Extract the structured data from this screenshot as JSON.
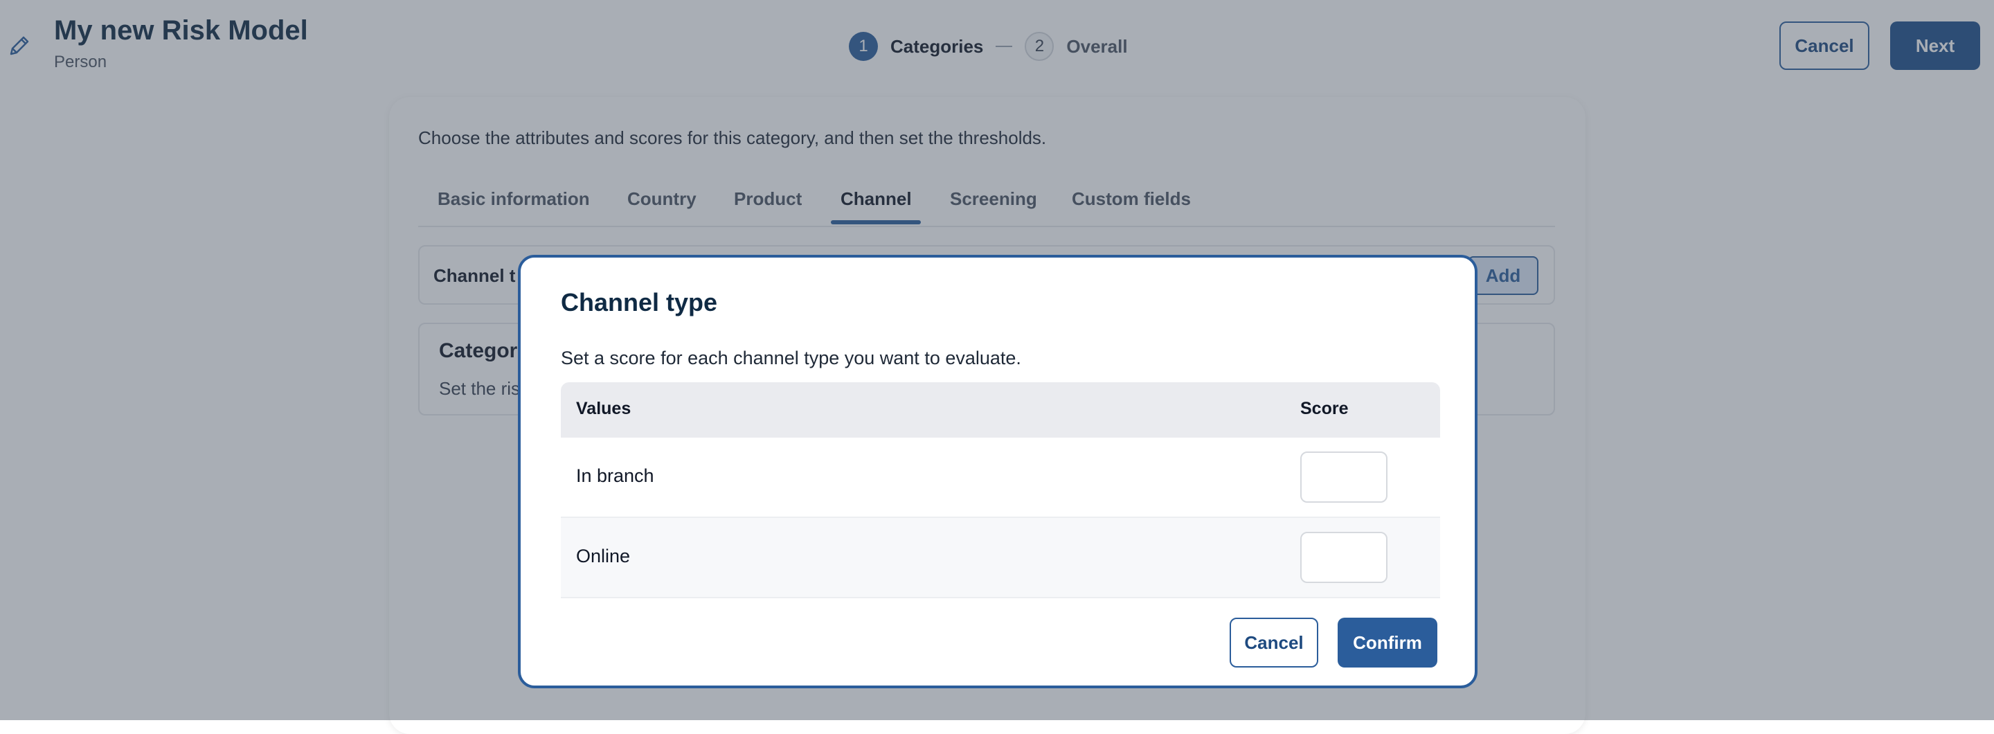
{
  "header": {
    "title": "My new Risk Model",
    "subtitle": "Person",
    "edit_icon": "pencil-icon",
    "steps": [
      {
        "number": "1",
        "label": "Categories",
        "active": true
      },
      {
        "number": "2",
        "label": "Overall",
        "active": false
      }
    ],
    "cancel_label": "Cancel",
    "next_label": "Next"
  },
  "main": {
    "intro": "Choose the attributes and scores for this category, and then set the thresholds.",
    "tabs": [
      {
        "label": "Basic information"
      },
      {
        "label": "Country"
      },
      {
        "label": "Product"
      },
      {
        "label": "Channel"
      },
      {
        "label": "Screening"
      },
      {
        "label": "Custom fields"
      }
    ],
    "active_tab": "Channel",
    "section1_label": "Channel t",
    "add_label": "Add",
    "section2_title": "Categor",
    "section2_desc": "Set the ris"
  },
  "modal": {
    "title": "Channel type",
    "description": "Set a score for each channel type you want to evaluate.",
    "columns": {
      "values": "Values",
      "score": "Score"
    },
    "rows": [
      {
        "value": "In branch",
        "score": ""
      },
      {
        "value": "Online",
        "score": ""
      }
    ],
    "cancel_label": "Cancel",
    "confirm_label": "Confirm"
  },
  "colors": {
    "primary": "#2b5d9b",
    "primary_dark": "#1e4f8a",
    "title": "#0f2a44",
    "overlay": "rgba(65,75,90,0.45)"
  }
}
